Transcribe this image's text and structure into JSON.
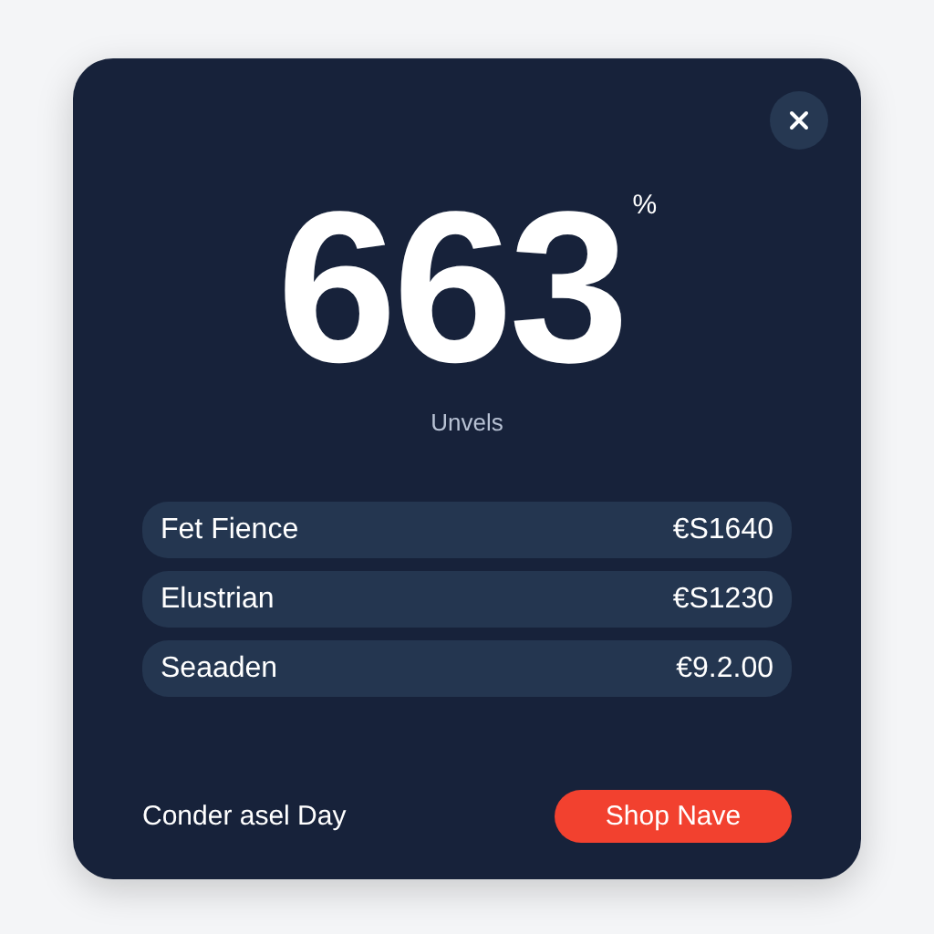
{
  "stat": {
    "value": "663",
    "unit": "%",
    "label": "Unvels"
  },
  "rows": [
    {
      "name": "Fet Fience",
      "price": "€S1640"
    },
    {
      "name": "Elustrian",
      "price": "€S1230"
    },
    {
      "name": "Seaaden",
      "price": "€9.2.00"
    }
  ],
  "footer": {
    "text": "Conder asel Day",
    "button": "Shop Nave"
  }
}
